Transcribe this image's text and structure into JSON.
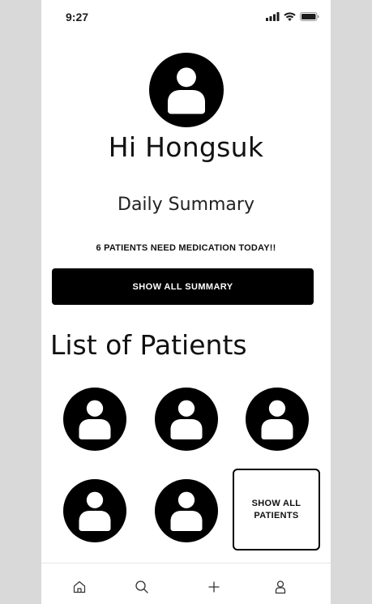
{
  "status_bar": {
    "time": "9:27",
    "icons": [
      "cellular-signal-icon",
      "wifi-icon",
      "battery-icon"
    ]
  },
  "profile": {
    "avatar_icon": "user-avatar-icon",
    "greeting": "Hi Hongsuk"
  },
  "summary": {
    "title": "Daily Summary",
    "alert": "6 PATIENTS NEED MEDICATION TODAY!!",
    "button_label": "SHOW ALL SUMMARY"
  },
  "patients": {
    "title": "List of Patients",
    "avatar_icon": "user-avatar-icon",
    "count_shown": 5,
    "show_all_label": "SHOW ALL PATIENTS"
  },
  "bottom_nav": {
    "items": [
      {
        "icon": "home-icon"
      },
      {
        "icon": "search-icon"
      },
      {
        "icon": "plus-icon"
      },
      {
        "icon": "profile-icon"
      }
    ]
  },
  "colors": {
    "background": "#ffffff",
    "frame": "#d9d9d9",
    "primary": "#000000",
    "on_primary": "#ffffff"
  }
}
